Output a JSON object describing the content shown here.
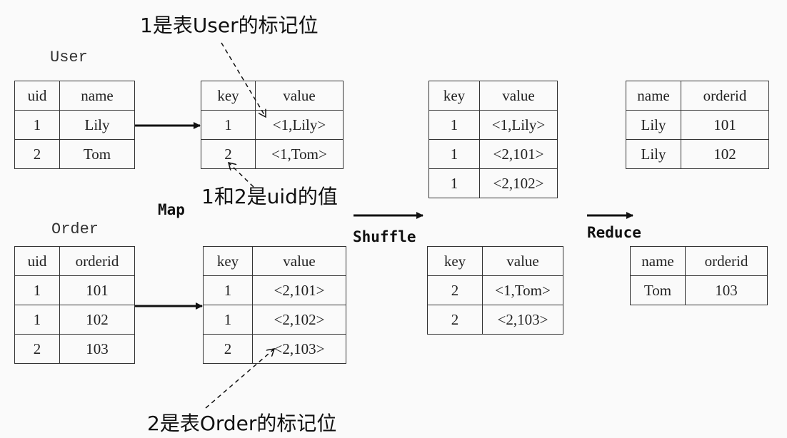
{
  "annotations": {
    "user_flag": "1是表User的标记位",
    "uid_values": "1和2是uid的值",
    "order_flag": "2是表Order的标记位"
  },
  "steps": {
    "map": "Map",
    "shuffle": "Shuffle",
    "reduce": "Reduce"
  },
  "tables": {
    "user": {
      "title": "User",
      "headers": [
        "uid",
        "name"
      ],
      "rows": [
        [
          "1",
          "Lily"
        ],
        [
          "2",
          "Tom"
        ]
      ]
    },
    "order": {
      "title": "Order",
      "headers": [
        "uid",
        "orderid"
      ],
      "rows": [
        [
          "1",
          "101"
        ],
        [
          "1",
          "102"
        ],
        [
          "2",
          "103"
        ]
      ]
    },
    "map_user": {
      "headers": [
        "key",
        "value"
      ],
      "rows": [
        [
          "1",
          "<1,Lily>"
        ],
        [
          "2",
          "<1,Tom>"
        ]
      ]
    },
    "map_order": {
      "headers": [
        "key",
        "value"
      ],
      "rows": [
        [
          "1",
          "<2,101>"
        ],
        [
          "1",
          "<2,102>"
        ],
        [
          "2",
          "<2,103>"
        ]
      ]
    },
    "shuffle_1": {
      "headers": [
        "key",
        "value"
      ],
      "rows": [
        [
          "1",
          "<1,Lily>"
        ],
        [
          "1",
          "<2,101>"
        ],
        [
          "1",
          "<2,102>"
        ]
      ]
    },
    "shuffle_2": {
      "headers": [
        "key",
        "value"
      ],
      "rows": [
        [
          "2",
          "<1,Tom>"
        ],
        [
          "2",
          "<2,103>"
        ]
      ]
    },
    "reduce_1": {
      "headers": [
        "name",
        "orderid"
      ],
      "rows": [
        [
          "Lily",
          "101"
        ],
        [
          "Lily",
          "102"
        ]
      ]
    },
    "reduce_2": {
      "headers": [
        "name",
        "orderid"
      ],
      "rows": [
        [
          "Tom",
          "103"
        ]
      ]
    }
  }
}
